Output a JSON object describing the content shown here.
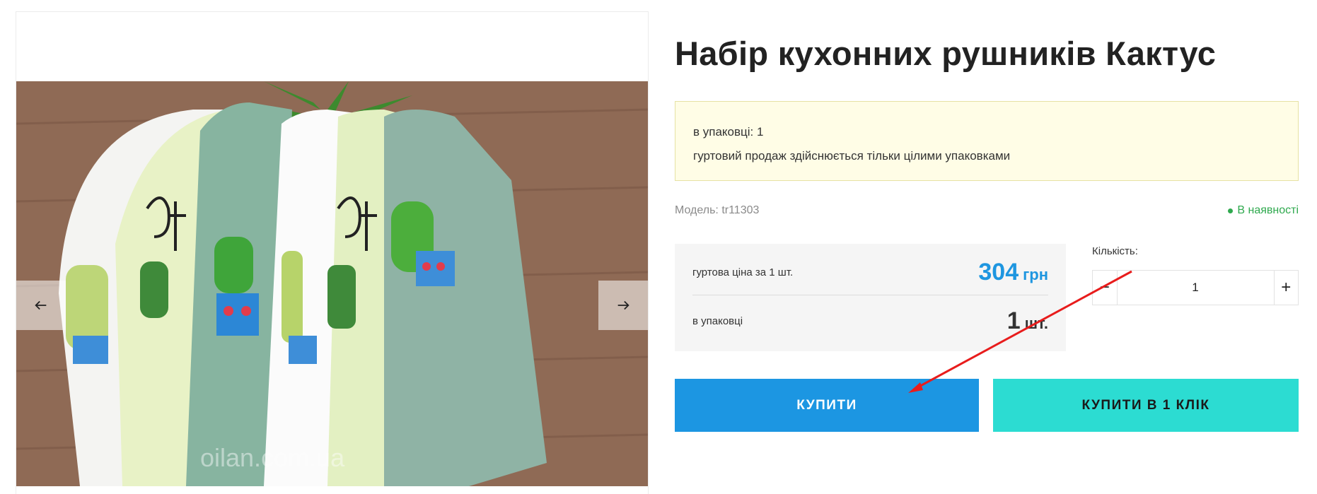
{
  "product": {
    "title": "Набір кухонних рушників Кактус",
    "image_alt": "Кухонні рушники з вишитими кактусами",
    "watermark": "oilan.com.ua"
  },
  "notice": {
    "line1": "в упаковці: 1",
    "line2": "гуртовий продаж здійснюється тільки цілими упаковками"
  },
  "model": {
    "label": "Модель: tr11303"
  },
  "stock": {
    "status": "В наявності",
    "color": "#2fa94e"
  },
  "price": {
    "label": "гуртова ціна за 1 шт.",
    "value": "304",
    "currency": "грн",
    "color": "#1e96e0"
  },
  "package": {
    "label": "в упаковці",
    "value": "1",
    "unit": "шт."
  },
  "quantity": {
    "label": "Кількість:",
    "value": "1",
    "minus": "−",
    "plus": "+"
  },
  "buttons": {
    "buy": "КУПИТИ",
    "buy_one_click": "КУПИТИ В 1 КЛІК",
    "buy_color": "#1c96e2",
    "one_click_color": "#2cdcd2"
  },
  "gallery": {
    "prev_icon": "arrow-left-icon",
    "next_icon": "arrow-right-icon"
  }
}
